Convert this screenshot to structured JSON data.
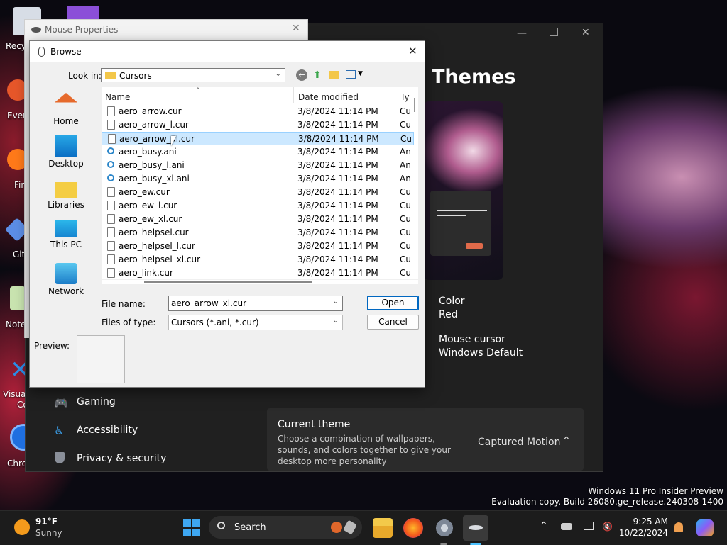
{
  "desktop": {
    "icons": [
      {
        "label": "Recy"
      },
      {
        "label": "Ever"
      },
      {
        "label": "Fir"
      },
      {
        "label": "Git"
      },
      {
        "label": "Note"
      },
      {
        "label": "Visual St"
      },
      {
        "label": "Cod"
      },
      {
        "label": "Chrom"
      }
    ],
    "watermark": {
      "line1": "Windows 11 Pro Insider Preview",
      "line2": "Evaluation copy. Build 26080.ge_release.240308-1400"
    }
  },
  "settings": {
    "page_title": "Themes",
    "color_label": "Color",
    "color_value": "Red",
    "cursor_label": "Mouse cursor",
    "cursor_value": "Windows Default",
    "nav": [
      "Gaming",
      "Accessibility",
      "Privacy & security"
    ],
    "current_theme": {
      "title": "Current theme",
      "description": "Choose a combination of wallpapers, sounds, and colors together to give your desktop more personality",
      "value": "Captured Motion"
    },
    "accent_color": "#e06a4a"
  },
  "mouse_properties": {
    "title": "Mouse Properties"
  },
  "browse": {
    "title": "Browse",
    "look_in_label": "Look in:",
    "look_in_value": "Cursors",
    "places": [
      "Home",
      "Desktop",
      "Libraries",
      "This PC",
      "Network"
    ],
    "columns": {
      "name": "Name",
      "date": "Date modified",
      "type": "Ty"
    },
    "files": [
      {
        "name": "aero_arrow.cur",
        "date": "3/8/2024 11:14 PM",
        "type": "Cu",
        "kind": "cur"
      },
      {
        "name": "aero_arrow_l.cur",
        "date": "3/8/2024 11:14 PM",
        "type": "Cu",
        "kind": "cur"
      },
      {
        "name": "aero_arrow_xl.cur",
        "date": "3/8/2024 11:14 PM",
        "type": "Cu",
        "kind": "cur",
        "selected": true
      },
      {
        "name": "aero_busy.ani",
        "date": "3/8/2024 11:14 PM",
        "type": "An",
        "kind": "ani"
      },
      {
        "name": "aero_busy_l.ani",
        "date": "3/8/2024 11:14 PM",
        "type": "An",
        "kind": "ani"
      },
      {
        "name": "aero_busy_xl.ani",
        "date": "3/8/2024 11:14 PM",
        "type": "An",
        "kind": "ani"
      },
      {
        "name": "aero_ew.cur",
        "date": "3/8/2024 11:14 PM",
        "type": "Cu",
        "kind": "cur"
      },
      {
        "name": "aero_ew_l.cur",
        "date": "3/8/2024 11:14 PM",
        "type": "Cu",
        "kind": "cur"
      },
      {
        "name": "aero_ew_xl.cur",
        "date": "3/8/2024 11:14 PM",
        "type": "Cu",
        "kind": "cur"
      },
      {
        "name": "aero_helpsel.cur",
        "date": "3/8/2024 11:14 PM",
        "type": "Cu",
        "kind": "cur"
      },
      {
        "name": "aero_helpsel_l.cur",
        "date": "3/8/2024 11:14 PM",
        "type": "Cu",
        "kind": "cur"
      },
      {
        "name": "aero_helpsel_xl.cur",
        "date": "3/8/2024 11:14 PM",
        "type": "Cu",
        "kind": "cur"
      },
      {
        "name": "aero_link.cur",
        "date": "3/8/2024 11:14 PM",
        "type": "Cu",
        "kind": "cur"
      }
    ],
    "file_name_label": "File name:",
    "file_name_value": "aero_arrow_xl.cur",
    "files_of_type_label": "Files of type:",
    "files_of_type_value": "Cursors (*.ani, *.cur)",
    "open_label": "Open",
    "cancel_label": "Cancel",
    "preview_label": "Preview:"
  },
  "taskbar": {
    "weather_temp": "91°F",
    "weather_desc": "Sunny",
    "search_label": "Search",
    "time": "9:25 AM",
    "date": "10/22/2024"
  }
}
